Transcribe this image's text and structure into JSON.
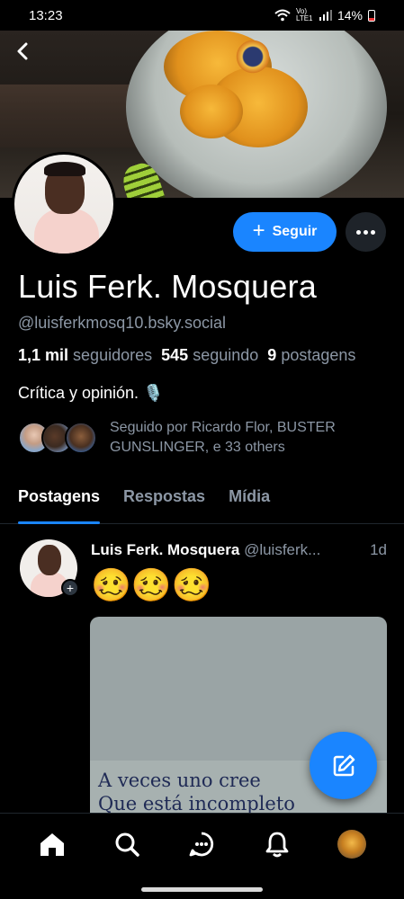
{
  "status_bar": {
    "time": "13:23",
    "network": "Vo) LTE1",
    "battery": "14%"
  },
  "profile": {
    "follow_label": "Seguir",
    "follow_plus": "+",
    "display_name": "Luis Ferk. Mosquera",
    "handle": "@luisferkmosq10.bsky.social",
    "stats": {
      "followers_count": "1,1 mil",
      "followers_label": "seguidores",
      "following_count": "545",
      "following_label": "seguindo",
      "posts_count": "9",
      "posts_label": "postagens"
    },
    "bio": "Crítica y opinión. 🎙️",
    "followed_by": "Seguido por Ricardo Flor, BUSTER GUNSLINGER, e 33 others"
  },
  "tabs": [
    {
      "label": "Postagens",
      "active": true
    },
    {
      "label": "Respostas",
      "active": false
    },
    {
      "label": "Mídia",
      "active": false
    }
  ],
  "post": {
    "author": "Luis Ferk. Mosquera",
    "handle": "@luisferk...",
    "time": "1d",
    "text": "🥴🥴🥴",
    "plus": "+",
    "image_lines": [
      "A veces uno cree",
      "Que está incompleto"
    ]
  },
  "colors": {
    "accent": "#1a85ff",
    "muted": "#8c97a5",
    "background": "#000000"
  },
  "icons": {
    "back": "chevron-left-icon",
    "compose": "compose-icon",
    "nav": [
      "home-icon",
      "search-icon",
      "chat-icon",
      "bell-icon",
      "profile-avatar"
    ]
  }
}
